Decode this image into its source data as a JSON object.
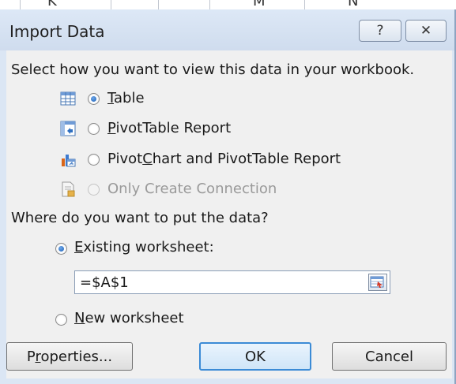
{
  "window": {
    "title": "Import Data",
    "help_glyph": "?",
    "close_glyph": "✕"
  },
  "view_section": {
    "prompt": "Select how you want to view this data in your workbook.",
    "options": [
      {
        "label_pre": "",
        "accel": "T",
        "label_post": "able",
        "icon": "table-icon",
        "checked": true,
        "enabled": true
      },
      {
        "label_pre": "",
        "accel": "P",
        "label_post": "ivotTable Report",
        "icon": "pivottable-icon",
        "checked": false,
        "enabled": true
      },
      {
        "label_pre": "Pivot",
        "accel": "C",
        "label_post": "hart and PivotTable Report",
        "icon": "pivotchart-icon",
        "checked": false,
        "enabled": true
      },
      {
        "label_pre": "Only Create Connection",
        "accel": "",
        "label_post": "",
        "icon": "connection-icon",
        "checked": false,
        "enabled": false
      }
    ]
  },
  "location_section": {
    "prompt": "Where do you want to put the data?",
    "existing": {
      "label_pre": "",
      "accel": "E",
      "label_post": "xisting worksheet:",
      "checked": true
    },
    "range_value": "=$A$1",
    "new": {
      "label_pre": "",
      "accel": "N",
      "label_post": "ew worksheet",
      "checked": false
    }
  },
  "buttons": {
    "properties": {
      "label_pre": "P",
      "accel": "r",
      "label_post": "operties..."
    },
    "ok": "OK",
    "cancel": "Cancel"
  },
  "background_sheet": {
    "glyphs": [
      "K",
      "M",
      "N"
    ]
  }
}
